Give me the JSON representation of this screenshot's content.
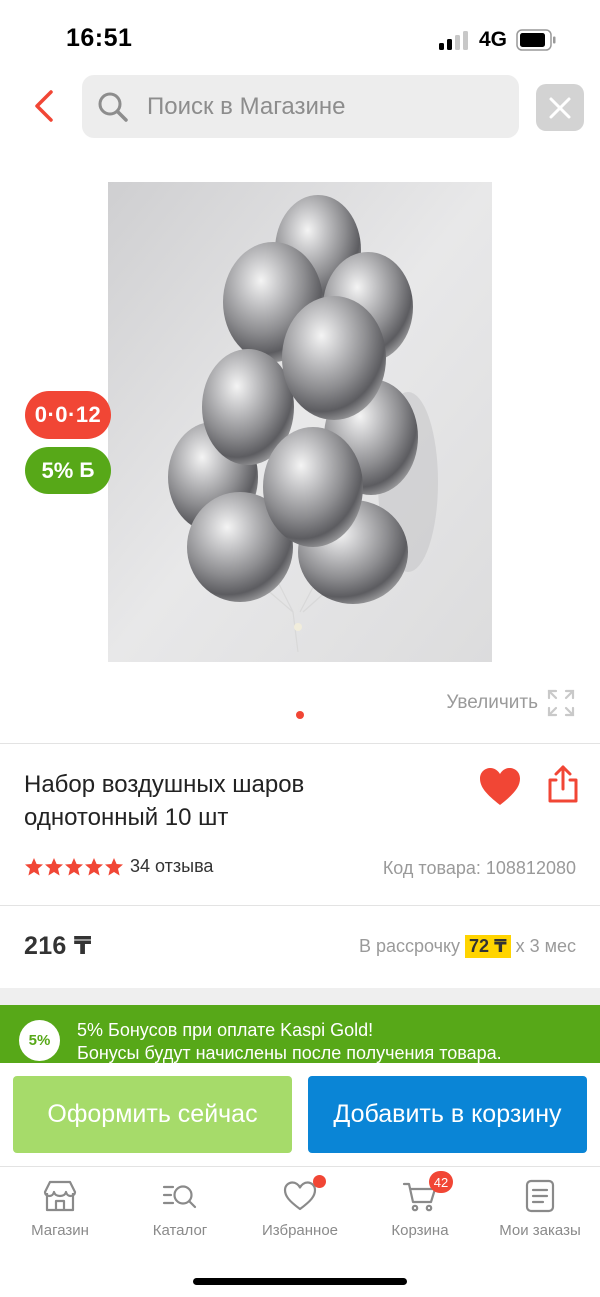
{
  "status_bar": {
    "time": "16:51",
    "network": "4G"
  },
  "search": {
    "placeholder": "Поиск в Магазине"
  },
  "badges": {
    "installment": "0·0·12",
    "bonus": "5%",
    "bonus_currency": "Б"
  },
  "gallery": {
    "zoom_label": "Увеличить"
  },
  "product": {
    "title_line1": "Набор воздушных шаров",
    "title_line2": "однотонный 10 шт",
    "rating": 5,
    "reviews": "34 отзыва",
    "sku_label": "Код товара:",
    "sku_value": "108812080",
    "price": "216 ₸",
    "installment_prefix": "В рассрочку",
    "installment_amount": "72 ₸",
    "installment_suffix": "х 3 мес"
  },
  "bonus_banner": {
    "badge": "5%",
    "line1": "5% Бонусов при оплате Kaspi Gold!",
    "line2": "Бонусы будут начислены после получения товара."
  },
  "actions": {
    "buy_now": "Оформить сейчас",
    "add_to_cart": "Добавить в корзину"
  },
  "tabs": [
    {
      "label": "Магазин",
      "icon": "store-icon"
    },
    {
      "label": "Каталог",
      "icon": "catalog-search-icon"
    },
    {
      "label": "Избранное",
      "icon": "heart-outline-icon"
    },
    {
      "label": "Корзина",
      "icon": "cart-icon",
      "badge": "42"
    },
    {
      "label": "Мои заказы",
      "icon": "orders-icon"
    }
  ],
  "colors": {
    "accent_red": "#f14635",
    "bonus_green": "#57a818",
    "buy_button": "#a6db6a",
    "cart_button": "#0a85d6",
    "installment_highlight": "#ffd400"
  }
}
